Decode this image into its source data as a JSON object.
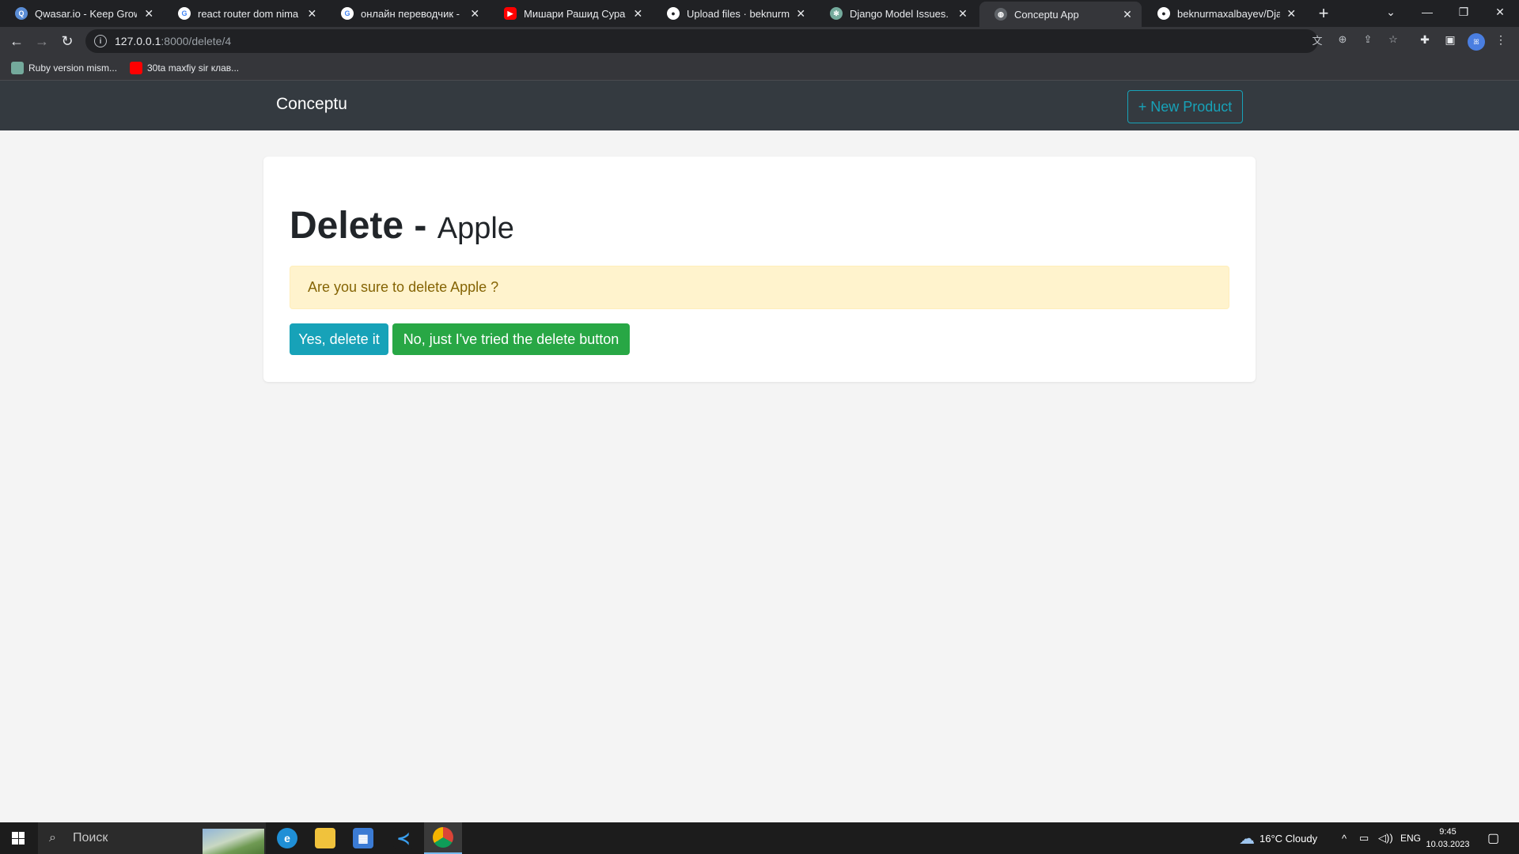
{
  "browser": {
    "tabs": [
      {
        "title": "Qwasar.io - Keep Growing",
        "icon": "qwasar-icon"
      },
      {
        "title": "react router dom nima - По",
        "icon": "google-icon"
      },
      {
        "title": "онлайн переводчик - Пои",
        "icon": "google-icon"
      },
      {
        "title": "Мишари Рашид Сура Яси",
        "icon": "youtube-icon"
      },
      {
        "title": "Upload files · beknurmaxal",
        "icon": "github-icon"
      },
      {
        "title": "Django Model Issues.",
        "icon": "chatgpt-icon"
      },
      {
        "title": "Conceptu App",
        "icon": "globe-icon"
      },
      {
        "title": "beknurmaxalbayev/Django",
        "icon": "github-icon"
      }
    ],
    "active_tab": 6,
    "url_host": "127.0.0.1",
    "url_path": ":8000/delete/4",
    "bookmarks": [
      {
        "label": "Ruby version mism...",
        "icon": "chatgpt-icon"
      },
      {
        "label": "30ta maxfiy sir клав...",
        "icon": "youtube-icon"
      }
    ],
    "profile_initials": "ꕤ"
  },
  "page": {
    "brand": "Conceptu",
    "new_product_label": "+ New Product",
    "heading_strong": "Delete - ",
    "heading_sub": "Apple",
    "alert_text": "Are you sure to delete Apple ?",
    "yes_label": "Yes, delete it",
    "no_label": "No, just I've tried the delete button"
  },
  "taskbar": {
    "search_placeholder": "Поиск",
    "weather": "16°C  Cloudy",
    "language": "ENG",
    "time": "9:45",
    "date": "10.03.2023"
  },
  "colors": {
    "navbar_bg": "#343a40",
    "info": "#17a2b8",
    "success": "#28a745",
    "alert_bg": "#fff3cd",
    "alert_text": "#856404"
  }
}
